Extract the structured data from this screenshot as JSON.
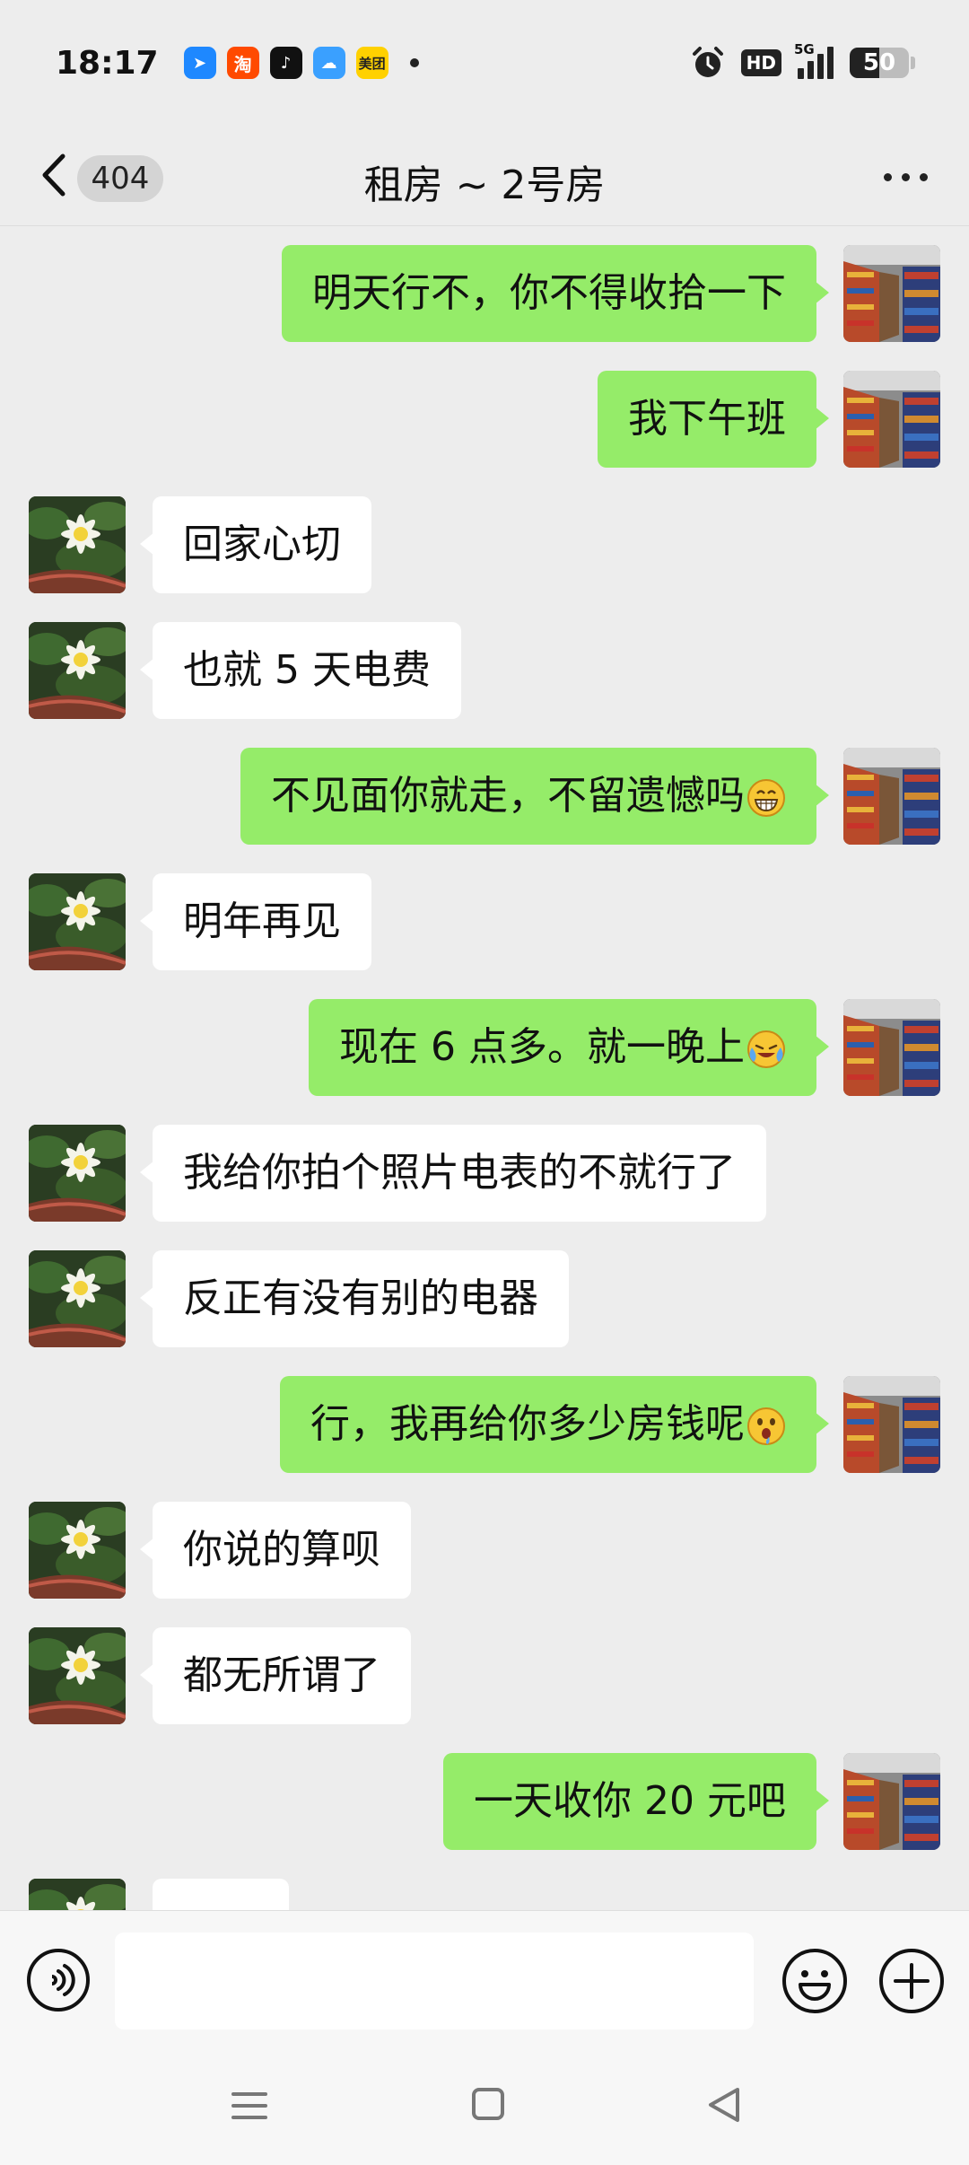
{
  "status_bar": {
    "time": "18:17",
    "network": "5G",
    "hd_label": "HD",
    "battery_level": "50",
    "battery_fraction": 0.5
  },
  "header": {
    "unread_count": "404",
    "title": "租房 ~ 2号房"
  },
  "messages": [
    {
      "side": "out",
      "text": "明天行不，你不得收拾一下"
    },
    {
      "side": "out",
      "text": "我下午班"
    },
    {
      "side": "in",
      "text": "回家心切"
    },
    {
      "side": "in",
      "text": "也就 5 天电费"
    },
    {
      "side": "out",
      "text": "不见面你就走，不留遗憾吗",
      "emoji": "grin-icon"
    },
    {
      "side": "in",
      "text": "明年再见"
    },
    {
      "side": "out",
      "text": "现在 6 点多。就一晚上",
      "emoji": "crying-laugh-icon"
    },
    {
      "side": "in",
      "text": "我给你拍个照片电表的不就行了"
    },
    {
      "side": "in",
      "text": "反正有没有别的电器"
    },
    {
      "side": "out",
      "text": "行，我再给你多少房钱呢",
      "emoji": "drooling-icon"
    },
    {
      "side": "in",
      "text": "你说的算呗"
    },
    {
      "side": "in",
      "text": "都无所谓了"
    },
    {
      "side": "out",
      "text": "一天收你 20 元吧"
    },
    {
      "side": "in",
      "text": ""
    }
  ],
  "input": {
    "value": "",
    "placeholder": ""
  },
  "icons": {
    "back": "chevron-left-icon",
    "more": "more-dots-icon",
    "voice": "voice-icon",
    "emoji": "emoji-icon",
    "plus": "plus-icon",
    "nav_menu": "menu-icon",
    "nav_home": "home-icon",
    "nav_back": "back-triangle-icon"
  },
  "colors": {
    "background": "#ededed",
    "outgoing_bubble": "#95ec69",
    "incoming_bubble": "#ffffff"
  }
}
